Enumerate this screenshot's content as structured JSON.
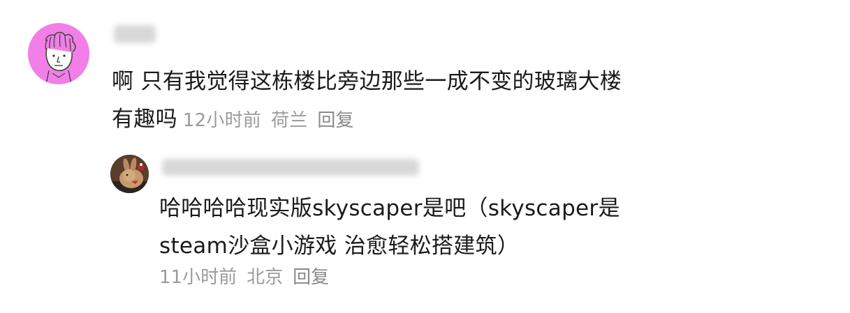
{
  "comment": {
    "username_blurred": true,
    "text_line1": "啊 只有我觉得这栋楼比旁边那些一成不变的玻璃大楼",
    "text_line2": "有趣吗",
    "time": "12小时前",
    "location": "荷兰",
    "reply_label": "回复"
  },
  "reply": {
    "username_blurred": true,
    "text_line1": "哈哈哈哈现实版skyscaper是吧（skyscaper是",
    "text_line2": "steam沙盒小游戏 治愈轻松搭建筑）",
    "time": "11小时前",
    "location": "北京",
    "reply_label": "回复"
  },
  "colors": {
    "main_text": "#1a1a1a",
    "meta_text": "#9b9b9b",
    "avatar_main_bg": "#f27ee8",
    "avatar_reply_bg": "#6b4a34"
  }
}
